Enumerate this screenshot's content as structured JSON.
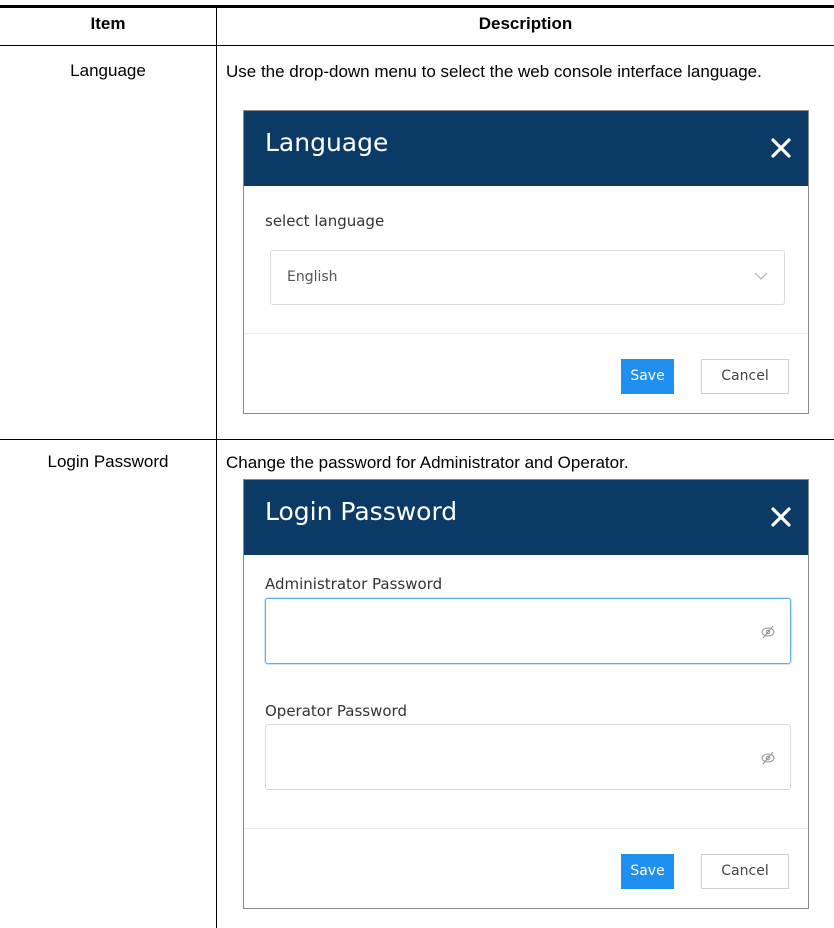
{
  "table": {
    "headers": {
      "item": "Item",
      "description": "Description"
    },
    "rows": [
      {
        "item": "Language",
        "description": "Use the drop-down menu to select the web console interface language.",
        "dialog": {
          "title": "Language",
          "field_label": "select language",
          "selected_value": "English",
          "save_label": "Save",
          "cancel_label": "Cancel"
        }
      },
      {
        "item": "Login Password",
        "description": "Change the password for Administrator and Operator.",
        "dialog": {
          "title": "Login Password",
          "admin_label": "Administrator Password",
          "admin_value": "",
          "operator_label": "Operator Password",
          "operator_value": "",
          "save_label": "Save",
          "cancel_label": "Cancel"
        }
      }
    ]
  },
  "colors": {
    "dialog_header": "#0c3a66",
    "primary_button": "#1f8ff0",
    "focus_border": "#5fb0f0"
  },
  "icons": {
    "close": "close-icon",
    "dropdown": "chevron-down-icon",
    "password_toggle": "eye-slash-icon"
  }
}
